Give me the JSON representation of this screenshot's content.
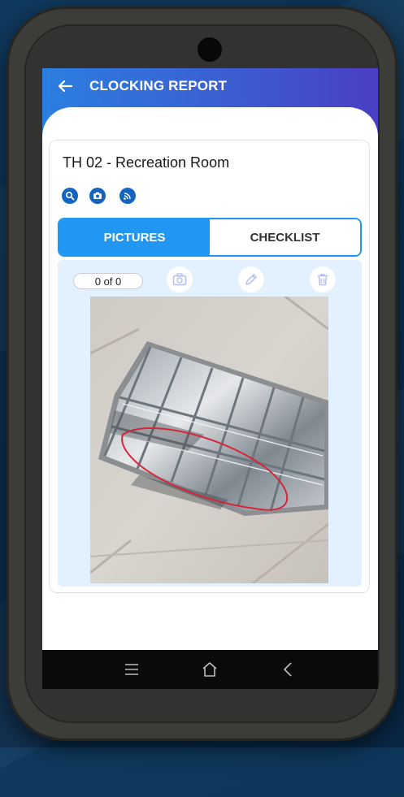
{
  "header": {
    "title": "CLOCKING REPORT"
  },
  "location": {
    "name": "TH 02 - Recreation Room"
  },
  "quick_actions": [
    "search-icon",
    "camera-icon",
    "nfc-icon"
  ],
  "tabs": [
    {
      "label": "PICTURES",
      "active": true
    },
    {
      "label": "CHECKLIST",
      "active": false
    }
  ],
  "pictures": {
    "counter": "0 of 0",
    "tools": [
      "camera-icon",
      "pencil-icon",
      "trash-icon"
    ]
  },
  "colors": {
    "primary": "#2196f3",
    "header_start": "#2b7fe0",
    "header_end": "#4a3fc2",
    "icon_bg": "#1565c0",
    "panel": "#e3f0fd",
    "annotation": "#d3273a"
  }
}
